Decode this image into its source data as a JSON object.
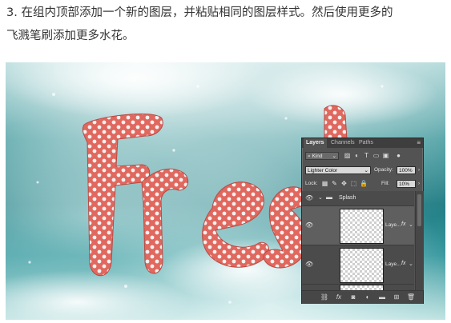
{
  "instructions": {
    "line1": "3. 在组内顶部添加一个新的图层，并粘贴相同的图层样式。然后使用更多的",
    "line2": "飞溅笔刷添加更多水花。"
  },
  "artwork": {
    "word": "Fresh"
  },
  "layers_panel": {
    "tabs": [
      "Layers",
      "Channels",
      "Paths"
    ],
    "filter_kind": "Kind",
    "blend_mode": "Lighter Color",
    "opacity_label": "Opacity:",
    "opacity_value": "100%",
    "lock_label": "Lock:",
    "fill_label": "Fill:",
    "fill_value": "10%",
    "group_name": "Splash",
    "layers": [
      {
        "name": "Laye...",
        "fx": "fx"
      },
      {
        "name": "Laye...",
        "fx": "fx"
      }
    ],
    "bottom_icons": [
      "link-icon",
      "fx-icon",
      "mask-icon",
      "adjustment-icon",
      "folder-icon",
      "new-layer-icon",
      "trash-icon"
    ]
  },
  "colors": {
    "text": "#333333",
    "panel_bg": "#535353",
    "letter_red": "#e0685f"
  }
}
